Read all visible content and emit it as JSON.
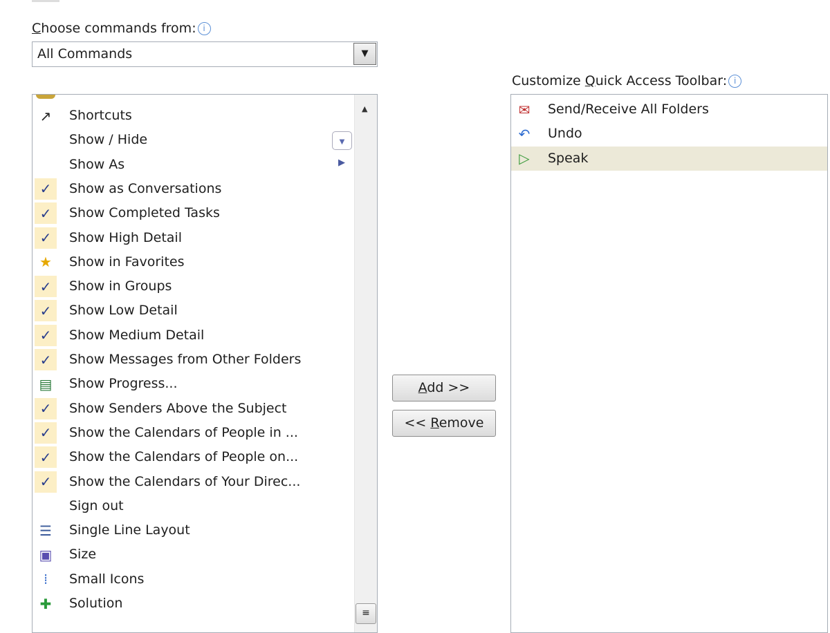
{
  "left": {
    "label_prefix": "C",
    "label_rest": "hoose commands from:",
    "combo_value": "All Commands",
    "items": [
      {
        "label": "Shortcuts",
        "icon": "shortcut-icon"
      },
      {
        "label": "Show / Hide",
        "icon": "",
        "extra": "dropdown"
      },
      {
        "label": "Show As",
        "icon": "",
        "extra": "submenu"
      },
      {
        "label": "Show as Conversations",
        "icon": "check-icon"
      },
      {
        "label": "Show Completed Tasks",
        "icon": "check-icon"
      },
      {
        "label": "Show High Detail",
        "icon": "check-icon"
      },
      {
        "label": "Show in Favorites",
        "icon": "favorites-folder-icon"
      },
      {
        "label": "Show in Groups",
        "icon": "check-icon"
      },
      {
        "label": "Show Low Detail",
        "icon": "check-icon"
      },
      {
        "label": "Show Medium Detail",
        "icon": "check-icon"
      },
      {
        "label": "Show Messages from Other Folders",
        "icon": "check-icon"
      },
      {
        "label": "Show Progress...",
        "icon": "progress-icon"
      },
      {
        "label": "Show Senders Above the Subject",
        "icon": "check-icon"
      },
      {
        "label": "Show the Calendars of People in ...",
        "icon": "check-icon"
      },
      {
        "label": "Show the Calendars of People on...",
        "icon": "check-icon"
      },
      {
        "label": "Show the Calendars of Your Direc...",
        "icon": "check-icon"
      },
      {
        "label": "Sign out",
        "icon": ""
      },
      {
        "label": "Single Line Layout",
        "icon": "single-line-layout-icon"
      },
      {
        "label": "Size",
        "icon": "size-icon"
      },
      {
        "label": "Small Icons",
        "icon": "small-icons-icon"
      },
      {
        "label": "Solution",
        "icon": "solution-icon"
      }
    ]
  },
  "buttons": {
    "add_u": "A",
    "add_rest": "dd >>",
    "remove_pre": "<< ",
    "remove_u": "R",
    "remove_rest": "emove"
  },
  "right": {
    "label_pre": "Customize ",
    "label_u": "Q",
    "label_rest": "uick Access Toolbar:",
    "items": [
      {
        "label": "Send/Receive All Folders",
        "icon": "send-receive-icon"
      },
      {
        "label": "Undo",
        "icon": "undo-icon"
      },
      {
        "label": "Speak",
        "icon": "speak-icon",
        "selected": true
      }
    ],
    "selected_color": "#ece9d8"
  },
  "colors": {
    "check_bg": "#fcefc6",
    "check": "#283d8c"
  }
}
